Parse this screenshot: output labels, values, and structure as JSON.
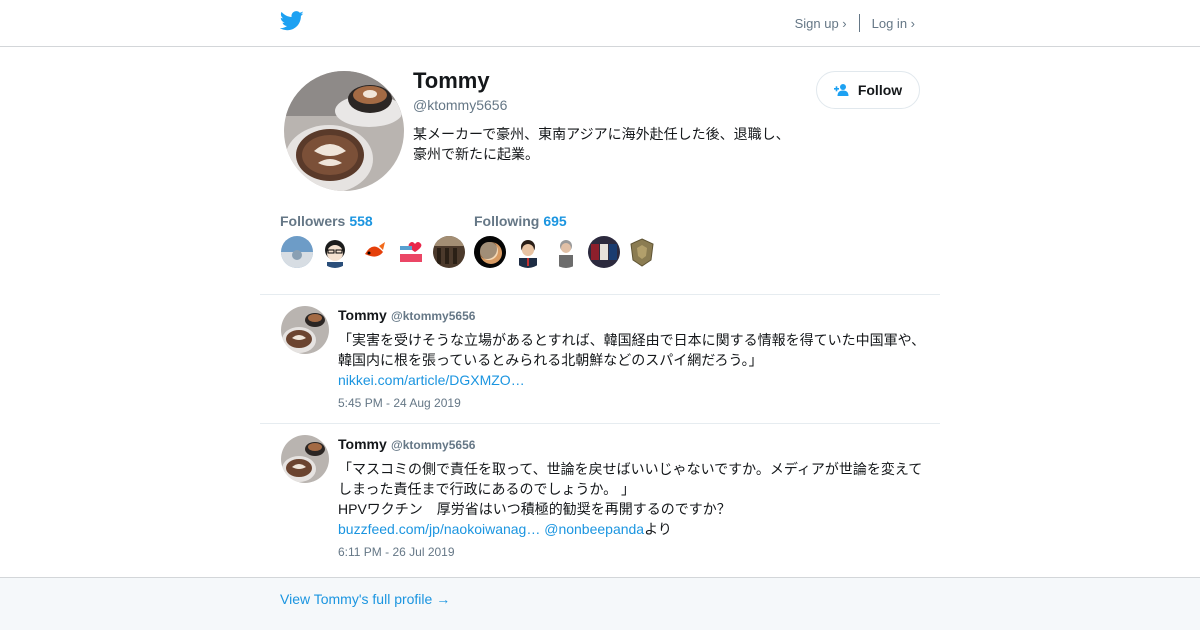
{
  "header": {
    "logo": "twitter-bird-icon",
    "signup_label": "Sign up ›",
    "login_label": "Log in ›"
  },
  "profile": {
    "name": "Tommy",
    "handle": "@ktommy5656",
    "bio_line1": "某メーカーで豪州、東南アジアに海外赴任した後、退職し、",
    "bio_line2": "豪州で新たに起業。",
    "follow_label": "Follow",
    "followers_label": "Followers",
    "followers_count": "558",
    "following_label": "Following",
    "following_count": "695"
  },
  "colors": {
    "accent": "#1b95e0",
    "brand": "#1da1f2",
    "muted": "#657786",
    "text": "#14171a"
  },
  "tweets": [
    {
      "name": "Tommy",
      "handle": "@ktommy5656",
      "line1": "「実害を受けそうな立場があるとすれば、韓国経由で日本に関する情報を得ていた中国軍や、",
      "line2": "韓国内に根を張っているとみられる北朝鮮などのスパイ網だろう。」",
      "link": "nikkei.com/article/DGXMZO…",
      "time": "5:45 PM - 24 Aug 2019"
    },
    {
      "name": "Tommy",
      "handle": "@ktommy5656",
      "line1": "「マスコミの側で責任を取って、世論を戻せばいいじゃないですか。メディアが世論を変えて",
      "line2": "しまった責任まで行政にあるのでしょうか。 」",
      "line3": "HPVワクチン　厚労省はいつ積極的勧奨を再開するのですか？",
      "link": "buzzfeed.com/jp/naokoiwanag…",
      "mention": "@nonbeepanda",
      "suffix": "より",
      "time": "6:11 PM - 26 Jul 2019"
    }
  ],
  "footer": {
    "full_profile_label": "View Tommy's full profile →"
  }
}
